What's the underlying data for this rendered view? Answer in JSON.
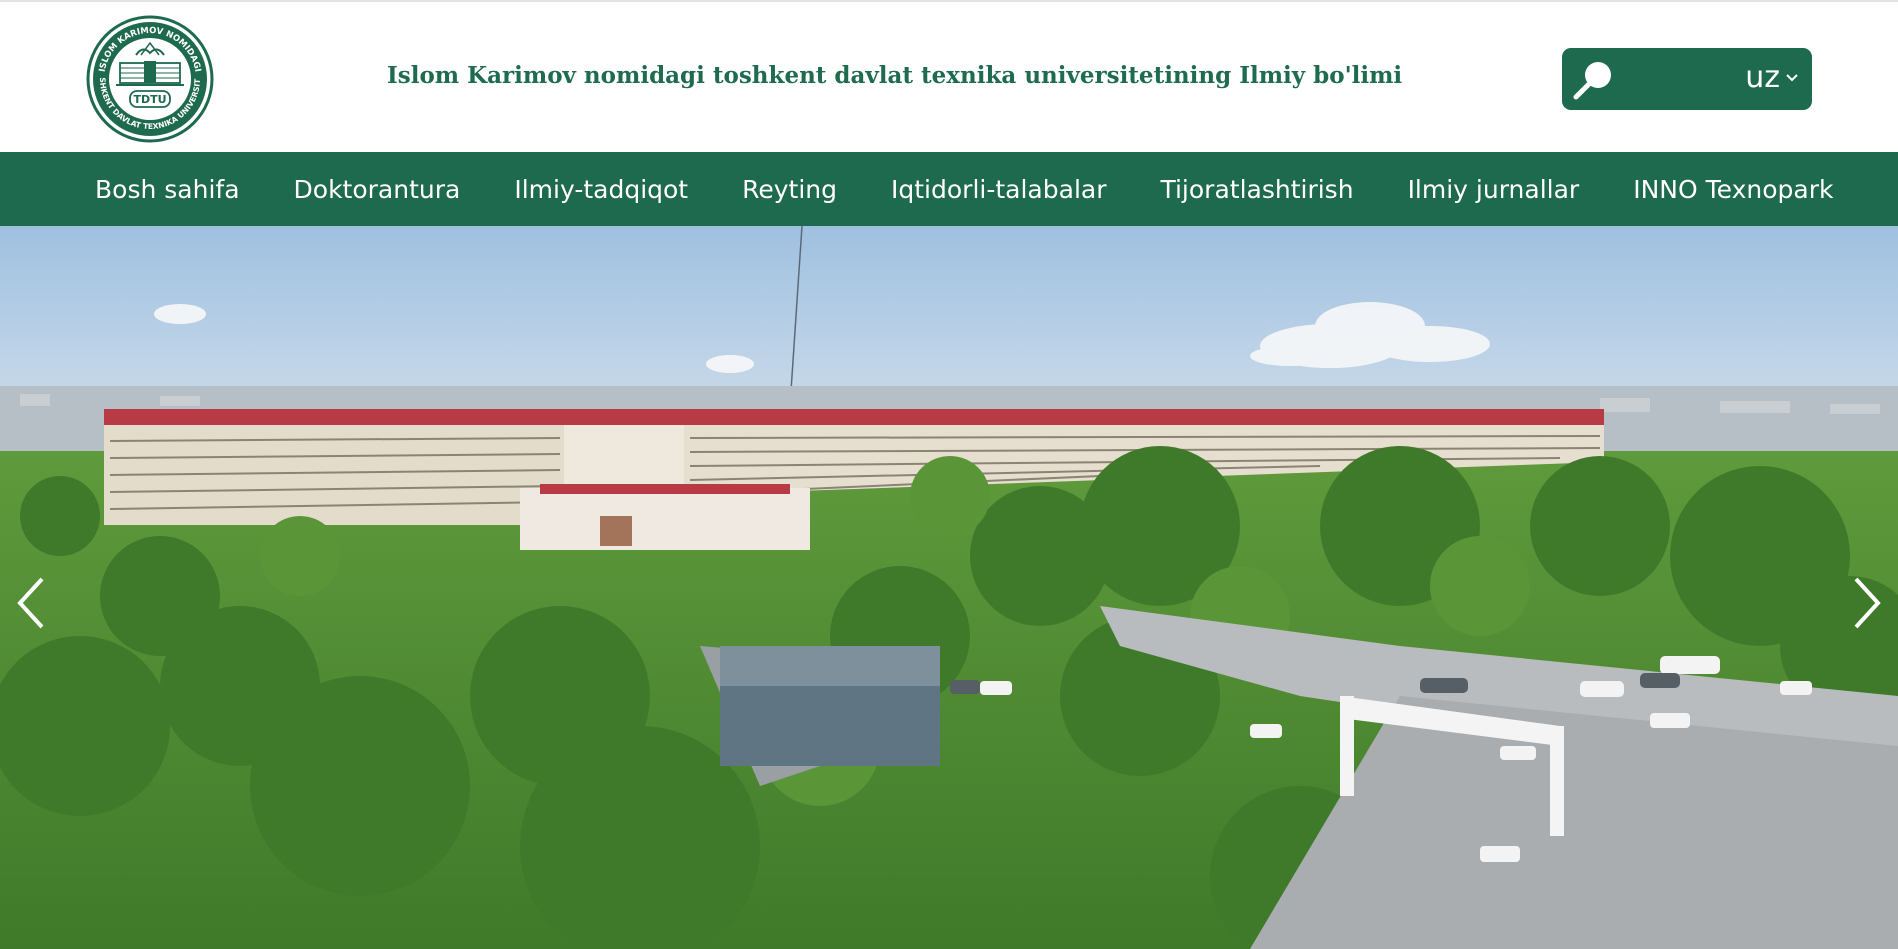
{
  "header": {
    "title": "Islom Karimov nomidagi toshkent davlat texnika universitetining Ilmiy bo'limi",
    "logo": {
      "ring_top_text": "ISLOM KARIMOV NOMIDAGI",
      "ring_bottom_text": "TOSHKENT DAVLAT TEXNIKA UNIVERSITETI",
      "abbreviation": "TDTU"
    },
    "search_icon": "search-icon",
    "language": "uz"
  },
  "nav": {
    "items": [
      {
        "label": "Bosh sahifa"
      },
      {
        "label": "Doktorantura"
      },
      {
        "label": "Ilmiy-tadqiqot"
      },
      {
        "label": "Reyting"
      },
      {
        "label": "Iqtidorli-talabalar"
      },
      {
        "label": "Tijoratlashtirish"
      },
      {
        "label": "Ilmiy jurnallar"
      },
      {
        "label": "INNO Texnopark"
      }
    ]
  },
  "hero": {
    "prev_icon": "chevron-left-icon",
    "next_icon": "chevron-right-icon"
  },
  "colors": {
    "brand_green": "#1e6a4e",
    "title_green": "#1f6b4f",
    "sky": "#a9c6e3",
    "roof_red": "#b83a44"
  }
}
